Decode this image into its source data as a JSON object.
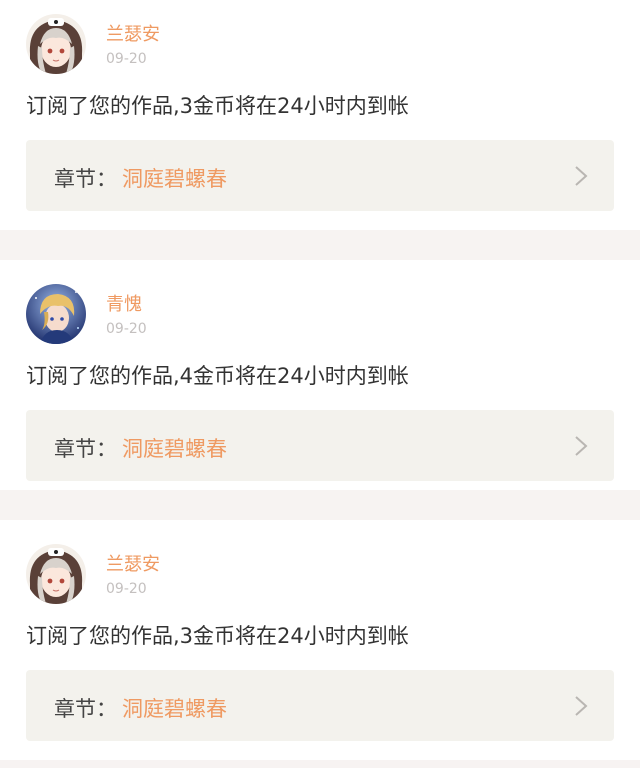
{
  "notifications": [
    {
      "user": "兰瑟安",
      "avatar": "girl-avatar",
      "date": "09-20",
      "message": "订阅了您的作品,3金币将在24小时内到帐",
      "chapter_label": "章节：",
      "chapter_name": "洞庭碧螺春"
    },
    {
      "user": "青愧",
      "avatar": "boy-avatar",
      "date": "09-20",
      "message": "订阅了您的作品,4金币将在24小时内到帐",
      "chapter_label": "章节：",
      "chapter_name": "洞庭碧螺春"
    },
    {
      "user": "兰瑟安",
      "avatar": "girl-avatar",
      "date": "09-20",
      "message": "订阅了您的作品,3金币将在24小时内到帐",
      "chapter_label": "章节：",
      "chapter_name": "洞庭碧螺春"
    }
  ],
  "colors": {
    "accent": "#ef9a62",
    "date": "#c4c0bf",
    "text": "#333333",
    "chapter_bg": "#f3f2ed",
    "page_bg": "#f7f3f2"
  },
  "icons": {
    "chevron": "chevron-right-icon"
  }
}
